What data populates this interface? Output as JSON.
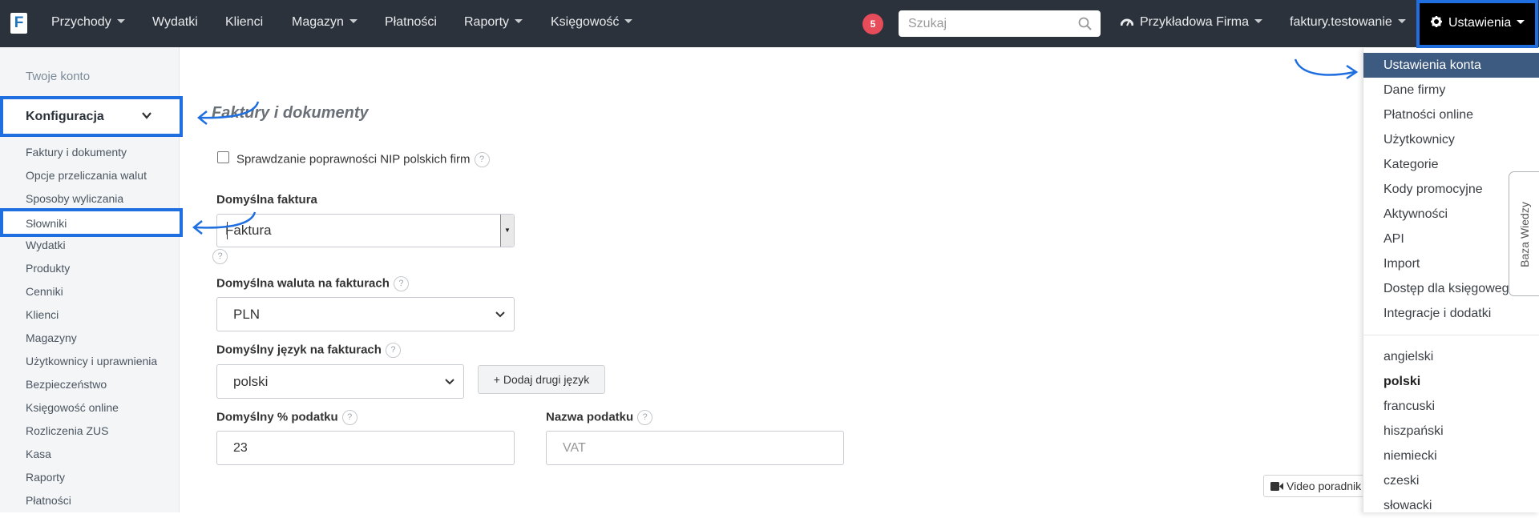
{
  "navbar": {
    "logo": "F",
    "items": [
      {
        "label": "Przychody",
        "dropdown": true
      },
      {
        "label": "Wydatki",
        "dropdown": false
      },
      {
        "label": "Klienci",
        "dropdown": false
      },
      {
        "label": "Magazyn",
        "dropdown": true
      },
      {
        "label": "Płatności",
        "dropdown": false
      },
      {
        "label": "Raporty",
        "dropdown": true
      },
      {
        "label": "Księgowość",
        "dropdown": true
      }
    ],
    "notifications_count": "5",
    "search_placeholder": "Szukaj",
    "company": "Przykładowa Firma",
    "user": "faktury.testowanie",
    "settings": "Ustawienia"
  },
  "sidebar": {
    "account": "Twoje konto",
    "section": "Konfiguracja",
    "items": [
      "Faktury i dokumenty",
      "Opcje przeliczania walut",
      "Sposoby wyliczania",
      "Słowniki",
      "Wydatki",
      "Produkty",
      "Cenniki",
      "Klienci",
      "Magazyny",
      "Użytkownicy i uprawnienia",
      "Bezpieczeństwo",
      "Księgowość online",
      "Rozliczenia ZUS",
      "Kasa",
      "Raporty",
      "Płatności"
    ]
  },
  "main": {
    "title": "Faktury i dokumenty",
    "nip_check_label": "Sprawdzanie poprawności NIP polskich firm",
    "nip_check_checked": false,
    "default_invoice_label": "Domyślna faktura",
    "default_invoice_value": "Faktura",
    "default_currency_label": "Domyślna waluta na fakturach",
    "default_currency_value": "PLN",
    "default_language_label": "Domyślny język na fakturach",
    "default_language_value": "polski",
    "add_language_button": "+ Dodaj drugi język",
    "default_tax_label": "Domyślny % podatku",
    "default_tax_value": "23",
    "tax_name_label": "Nazwa podatku",
    "tax_name_placeholder": "VAT",
    "video_button": "Video poradnik",
    "help_glyph": "?"
  },
  "dropdown": {
    "settings_items": [
      "Ustawienia konta",
      "Dane firmy",
      "Płatności online",
      "Użytkownicy",
      "Kategorie",
      "Kody promocyjne",
      "Aktywności",
      "API",
      "Import",
      "Dostęp dla księgowego",
      "Integracje i dodatki"
    ],
    "languages": [
      "angielski",
      "polski",
      "francuski",
      "hiszpański",
      "niemiecki",
      "czeski",
      "słowacki"
    ],
    "selected_language": "polski",
    "active_item": "Ustawienia konta"
  },
  "knowledge_base": "Baza Wiedzy",
  "colors": {
    "navbar_bg": "#2b323b",
    "highlight_blue": "#1f6fe0",
    "menu_active": "#3d5a80",
    "badge_red": "#e74c5b"
  }
}
